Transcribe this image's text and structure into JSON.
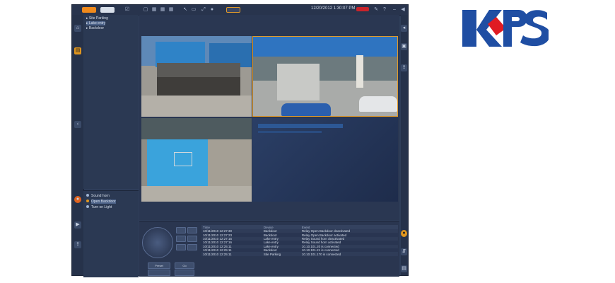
{
  "brand": {
    "logo_text": "KPS",
    "colors": {
      "blue": "#1f4ea3",
      "red": "#e01b22"
    }
  },
  "app": {
    "toolbar": {
      "mode_icons": [
        "live-view-icon",
        "playback-icon",
        "checkbox-icon"
      ],
      "layout_icons": [
        "layout-1x1-icon",
        "layout-2x2-icon",
        "layout-3x3-icon",
        "layout-4x4-icon"
      ],
      "tool_icons": [
        "cursor-icon",
        "export-icon",
        "fullscreen-icon",
        "record-icon"
      ],
      "clock": "12/20/2012 1:30:07 PM",
      "right_icons": [
        "alarm-icon",
        "tool-icon",
        "help-icon",
        "minimize-icon",
        "audio-icon"
      ]
    },
    "tree": {
      "items": [
        {
          "label": "Site Parking"
        },
        {
          "label": "Lake entry"
        },
        {
          "label": "Backdoor"
        }
      ]
    },
    "relays": {
      "items": [
        {
          "label": "Sound horn"
        },
        {
          "label": "Open Backdoor"
        },
        {
          "label": "Turn on Light"
        }
      ]
    },
    "video": {
      "tiles": [
        "camera-tile-1",
        "camera-tile-2",
        "camera-tile-3",
        "camera-tile-4"
      ]
    },
    "log": {
      "headers": [
        "Time",
        "Device",
        "Event"
      ],
      "rows": [
        {
          "time": "10/11/2010 12:27:30",
          "device": "Backdoor",
          "event": "Relay Open Backdoor deactivated"
        },
        {
          "time": "10/11/2010 12:27:23",
          "device": "Backdoor",
          "event": "Relay Open Backdoor activated"
        },
        {
          "time": "10/11/2010 12:27:15",
          "device": "Lake entry",
          "event": "Relay Sound horn deactivated"
        },
        {
          "time": "10/11/2010 12:27:16",
          "device": "Lake entry",
          "event": "Relay Sound horn activated"
        },
        {
          "time": "10/11/2010 12:25:11",
          "device": "Lake entry",
          "event": "10.10.101.20 is connected"
        },
        {
          "time": "10/11/2010 12:25:11",
          "device": "Backdoor",
          "event": "10.10.101.21 is connected"
        },
        {
          "time": "10/11/2010 12:25:11",
          "device": "Site Parking",
          "event": "10.10.101.170 is connected"
        }
      ]
    },
    "ptz": {
      "presets": [
        "Preset",
        "Go"
      ]
    }
  }
}
